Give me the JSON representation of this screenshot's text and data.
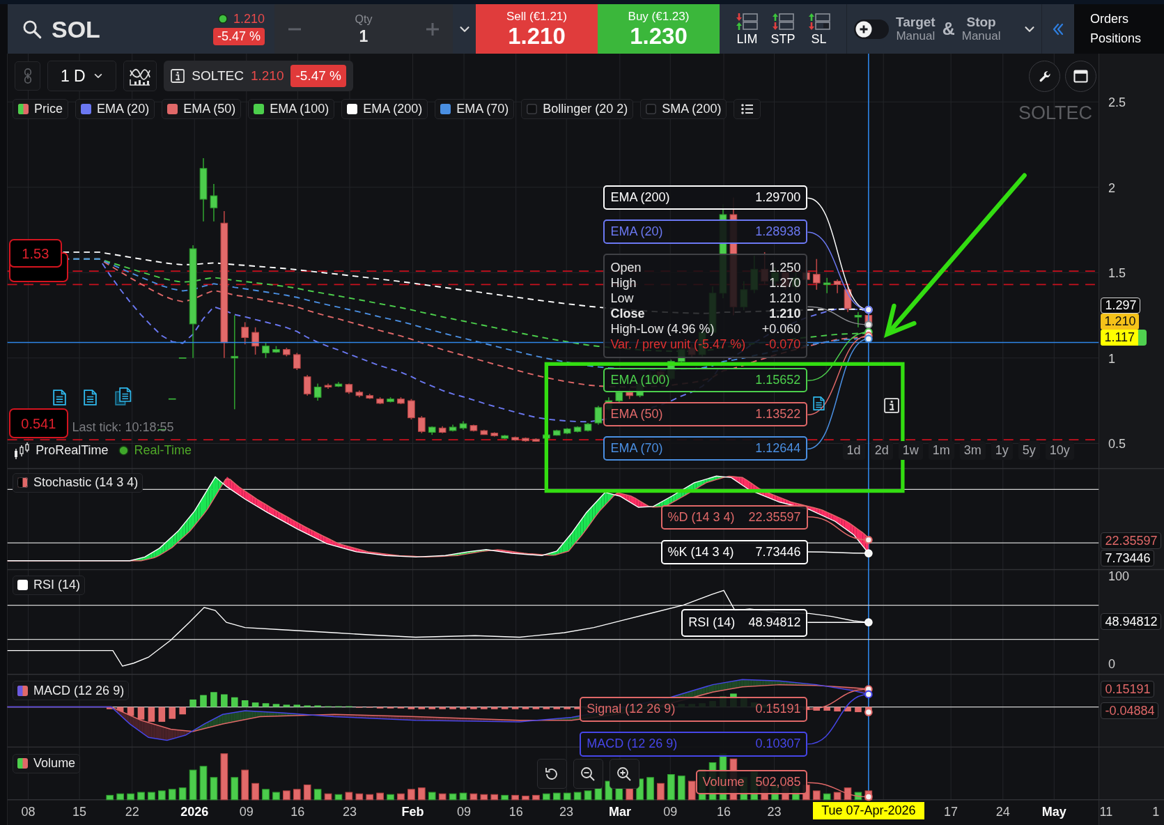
{
  "top_bar": {
    "symbol": "SOL",
    "quote": {
      "live": true,
      "price": "1.210",
      "change": "-5.47 %"
    },
    "quantity": {
      "label": "Qty",
      "value": "1"
    },
    "sell": {
      "label": "Sell (€1.21)",
      "price": "1.210"
    },
    "buy": {
      "label": "Buy (€1.23)",
      "price": "1.230"
    },
    "order_types": [
      {
        "kind": "limit",
        "label": "LIM"
      },
      {
        "kind": "stop",
        "label": "STP"
      },
      {
        "kind": "stop_limit",
        "label": "SL"
      }
    ],
    "bracket": {
      "on": false,
      "target": {
        "label": "Target",
        "mode": "Manual"
      },
      "joiner": "&",
      "stop": {
        "label": "Stop",
        "mode": "Manual"
      }
    },
    "account_links": [
      "Orders",
      "Positions"
    ]
  },
  "chart": {
    "toolbar": {
      "timeframe": "1 D",
      "instrument": "SOLTEC",
      "price": "1.210",
      "change": "-5.47 %"
    },
    "legend": [
      {
        "kind": "candles",
        "label": "Price",
        "checked": true
      },
      {
        "kind": "line",
        "label": "EMA (20)",
        "checked": true,
        "color": "#6b78f2"
      },
      {
        "kind": "line",
        "label": "EMA (50)",
        "checked": true,
        "color": "#e06868"
      },
      {
        "kind": "line",
        "label": "EMA (100)",
        "checked": true,
        "color": "#4ccf4c"
      },
      {
        "kind": "line",
        "label": "EMA (200)",
        "checked": true,
        "color": "#ffffff"
      },
      {
        "kind": "line",
        "label": "EMA (70)",
        "checked": true,
        "color": "#4a8fe2"
      },
      {
        "kind": "bands",
        "label": "Bollinger (20 2)",
        "checked": false
      },
      {
        "kind": "line",
        "label": "SMA (200)",
        "checked": false
      }
    ],
    "symbol_label": "SOLTEC",
    "price_axis": {
      "ticks": [
        "2.5",
        "2",
        "1.5",
        "1",
        "0.5"
      ],
      "tags": [
        {
          "kind": "indicator",
          "text": "1.297"
        },
        {
          "kind": "last",
          "text": "1.210"
        },
        {
          "kind": "cursor",
          "text": "1.117"
        }
      ]
    },
    "level_tags": [
      "1.53",
      "0.541"
    ],
    "last_tick": "Last tick: 10:18:55",
    "feed": {
      "provider": "ProRealTime",
      "status": "Real-Time",
      "live": true
    },
    "periods": [
      "1d",
      "2d",
      "1w",
      "1m",
      "3m",
      "1y",
      "5y",
      "10y"
    ],
    "tooltip": [
      {
        "kind": "series",
        "label": "EMA (200)",
        "value": "1.29700",
        "color": "#ffffff"
      },
      {
        "kind": "series",
        "label": "EMA (20)",
        "value": "1.28938",
        "color": "#6b78f2"
      },
      {
        "kind": "ohlc",
        "rows": [
          {
            "kind": "normal",
            "label": "Open",
            "value": "1.250"
          },
          {
            "kind": "normal",
            "label": "High",
            "value": "1.270"
          },
          {
            "kind": "normal",
            "label": "Low",
            "value": "1.210"
          },
          {
            "kind": "bold",
            "label": "Close",
            "value": "1.210"
          },
          {
            "kind": "normal",
            "label": "High-Low (4.96 %)",
            "value": "+0.060"
          },
          {
            "kind": "negative",
            "label": "Var. / prev unit (-5.47 %)",
            "value": "-0.070"
          }
        ]
      },
      {
        "kind": "series",
        "label": "EMA (100)",
        "value": "1.15652",
        "color": "#4ccf4c"
      },
      {
        "kind": "series",
        "label": "EMA (50)",
        "value": "1.13522",
        "color": "#e06868"
      },
      {
        "kind": "series",
        "label": "EMA (70)",
        "value": "1.12644",
        "color": "#4a8fe2"
      }
    ]
  },
  "panes": [
    {
      "kind": "stochastic",
      "label": "Stochastic (14 3 4)",
      "readouts": [
        {
          "label": "%D (14 3 4)",
          "value": "22.35597",
          "color": "#e06868"
        },
        {
          "label": "%K (14 3 4)",
          "value": "7.73446",
          "color": "#ffffff"
        }
      ],
      "axis_tags": [
        {
          "text": "22.35597",
          "color": "#e06868"
        },
        {
          "text": "7.73446",
          "color": "#ffffff"
        }
      ]
    },
    {
      "kind": "rsi",
      "label": "RSI (14)",
      "readouts": [
        {
          "label": "RSI (14)",
          "value": "48.94812",
          "color": "#ffffff"
        }
      ],
      "axis_ticks": [
        "100",
        "0"
      ],
      "axis_tags": [
        {
          "text": "48.94812",
          "color": "#ffffff"
        }
      ]
    },
    {
      "kind": "macd",
      "label": "MACD (12 26 9)",
      "readouts": [
        {
          "label": "Signal (12 26 9)",
          "value": "0.15191",
          "color": "#e06868"
        },
        {
          "label": "MACD (12 26 9)",
          "value": "0.10307",
          "color": "#4646e8"
        }
      ],
      "axis_tags": [
        {
          "text": "0.15191",
          "color": "#e06868"
        },
        {
          "text": "-0.04884",
          "color": "#e06868"
        }
      ]
    },
    {
      "kind": "volume",
      "label": "Volume",
      "readouts": [
        {
          "label": "Volume",
          "value": "502,085",
          "color": "#e06868"
        }
      ]
    }
  ],
  "x_axis": {
    "labels": [
      {
        "text": "08",
        "bold": false
      },
      {
        "text": "15",
        "bold": false
      },
      {
        "text": "22",
        "bold": false
      },
      {
        "text": "2026",
        "bold": true
      },
      {
        "text": "09",
        "bold": false
      },
      {
        "text": "16",
        "bold": false
      },
      {
        "text": "23",
        "bold": false
      },
      {
        "text": "Feb",
        "bold": true
      },
      {
        "text": "09",
        "bold": false
      },
      {
        "text": "16",
        "bold": false
      },
      {
        "text": "23",
        "bold": false
      },
      {
        "text": "Mar",
        "bold": true
      },
      {
        "text": "09",
        "bold": false
      },
      {
        "text": "16",
        "bold": false
      },
      {
        "text": "23",
        "bold": false
      },
      {
        "text": "17",
        "bold": false
      },
      {
        "text": "24",
        "bold": false
      },
      {
        "text": "May",
        "bold": true
      },
      {
        "text": "11",
        "bold": false
      },
      {
        "text": "1",
        "bold": false
      }
    ],
    "cursor_date": "Tue 07-Apr-2026"
  }
}
